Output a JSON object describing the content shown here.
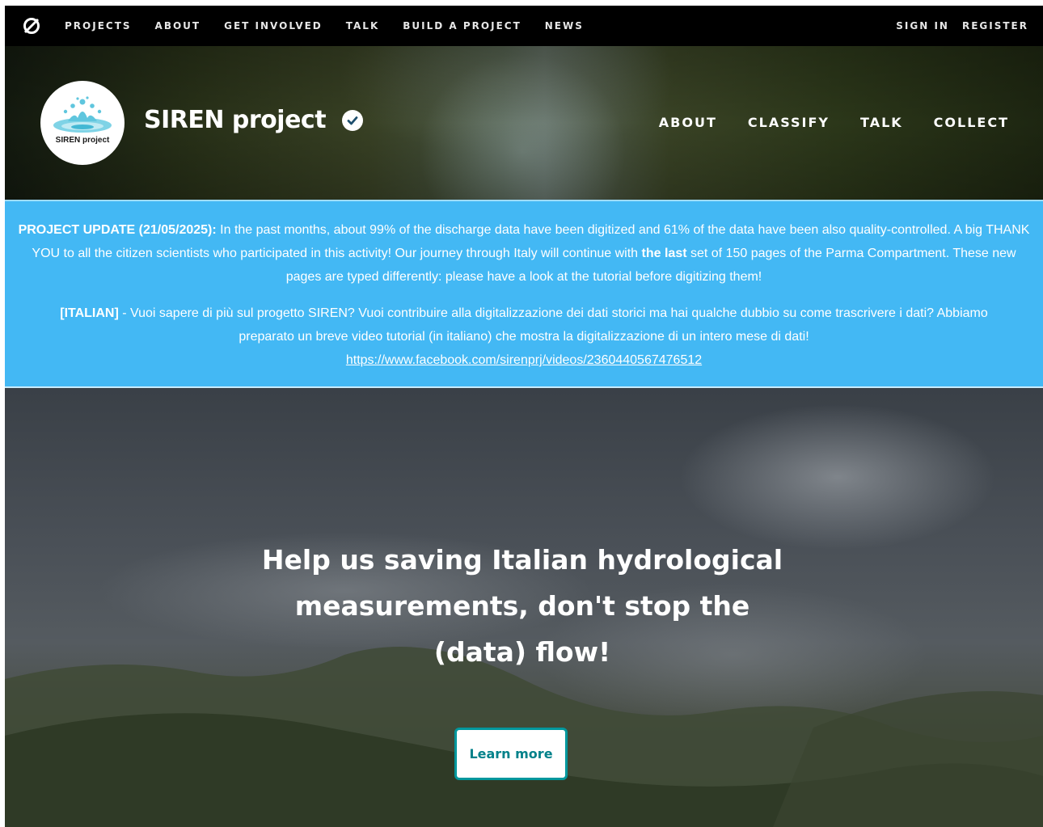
{
  "topnav": {
    "logo_icon": "zooniverse-logo-icon",
    "links": [
      "PROJECTS",
      "ABOUT",
      "GET INVOLVED",
      "TALK",
      "BUILD A PROJECT",
      "NEWS"
    ],
    "sign_in": "SIGN IN",
    "register": "REGISTER"
  },
  "project": {
    "name": "SIREN project",
    "logo_text": "SIREN project",
    "verified_icon": "verified-check-icon",
    "nav": [
      "ABOUT",
      "CLASSIFY",
      "TALK",
      "COLLECT"
    ]
  },
  "announcement": {
    "update_label": "PROJECT UPDATE (21/05/2025):",
    "update_text_1": " In the past months, about 99% of the discharge data have been digitized and 61% of the data have been also quality-controlled. A big THANK YOU to all the citizen scientists who participated in this activity! Our journey through Italy will continue with ",
    "update_bold": "the last",
    "update_text_2": " set of 150 pages of the Parma Compartment. These new pages are typed differently: please have a look at the tutorial before digitizing them!",
    "italian_label": "[ITALIAN]",
    "italian_text": " - Vuoi sapere di più sul progetto SIREN? Vuoi contribuire alla digitalizzazione dei dati storici ma hai qualche dubbio su come trascrivere i dati? Abbiamo preparato un breve video tutorial (in italiano) che mostra la digitalizzazione di un intero mese di dati!",
    "link": "https://www.facebook.com/sirenprj/videos/2360440567476512",
    "background": "#43b8f4"
  },
  "hero": {
    "line1": "Help us saving Italian hydrological",
    "line2": "measurements, don't stop the",
    "line3": "(data) flow!",
    "button": "Learn more",
    "button_color": "#00979d"
  }
}
